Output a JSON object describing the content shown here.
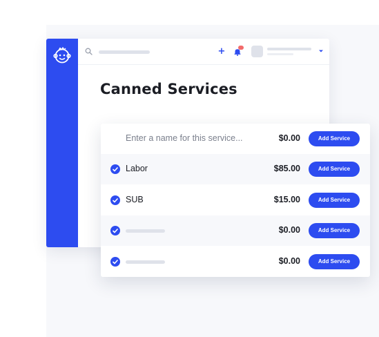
{
  "page": {
    "title": "Canned Services"
  },
  "topbar": {
    "search_icon": "search-icon",
    "add_icon": "plus-icon",
    "notification_icon": "bell-icon",
    "avatar_icon": "avatar",
    "menu_icon": "chevron-down-icon"
  },
  "sidebar": {
    "logo_icon": "monkey-logo-icon"
  },
  "colors": {
    "brand": "#2d4cf0",
    "badge": "#f26b6b",
    "text": "#1b1d24"
  },
  "services": {
    "new_service": {
      "placeholder": "Enter a name for this service...",
      "price": "$0.00",
      "button_label": "Add Service"
    },
    "rows": [
      {
        "name": "Labor",
        "price": "$85.00",
        "button_label": "Add Service",
        "checked": true
      },
      {
        "name": "SUB",
        "price": "$15.00",
        "button_label": "Add Service",
        "checked": true
      },
      {
        "name": "",
        "price": "$0.00",
        "button_label": "Add Service",
        "checked": true
      },
      {
        "name": "",
        "price": "$0.00",
        "button_label": "Add Service",
        "checked": true
      }
    ]
  }
}
